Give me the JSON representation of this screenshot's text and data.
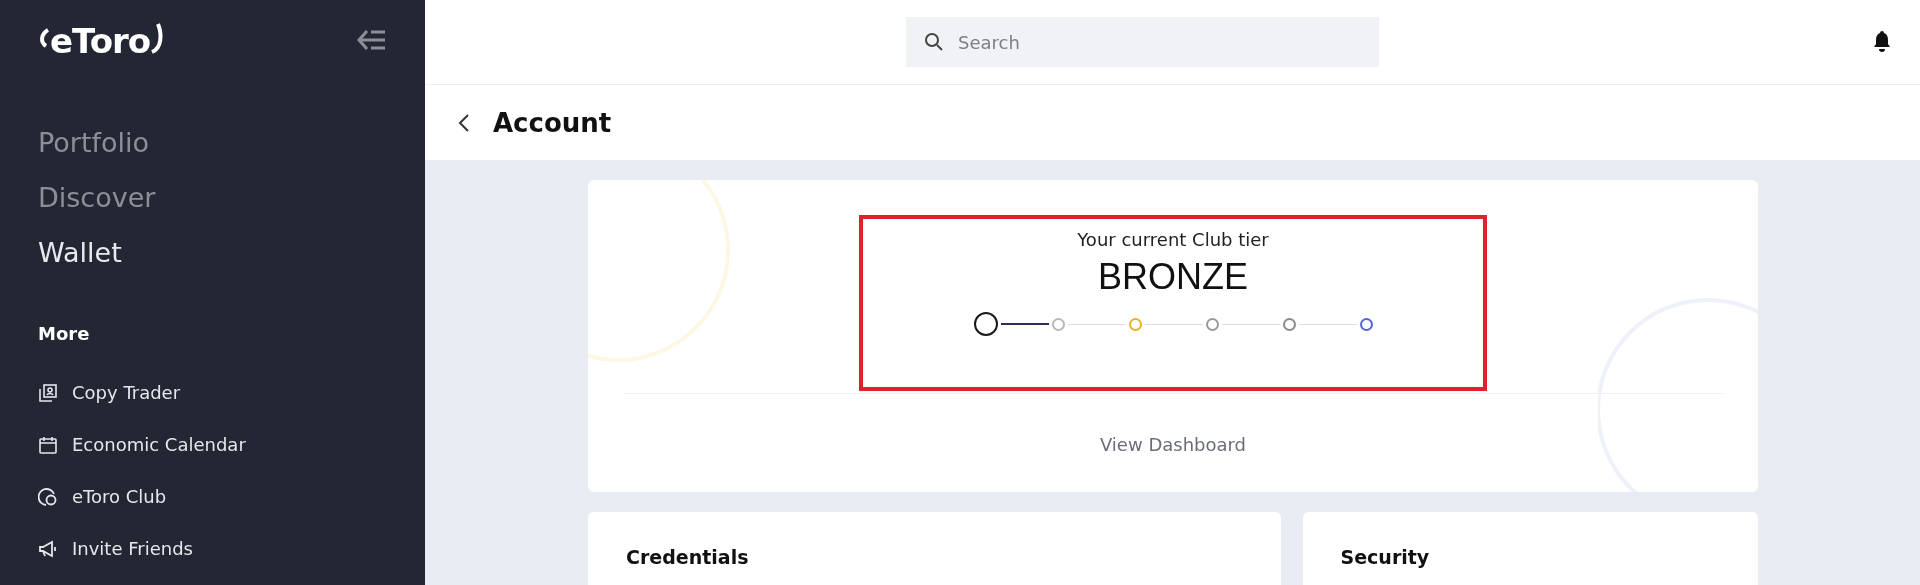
{
  "sidebar": {
    "logo": "eToro",
    "nav": [
      {
        "label": "Portfolio",
        "selected": false
      },
      {
        "label": "Discover",
        "selected": false
      },
      {
        "label": "Wallet",
        "selected": true
      }
    ],
    "more_heading": "More",
    "more_items": [
      {
        "label": "Copy Trader"
      },
      {
        "label": "Economic Calendar"
      },
      {
        "label": "eToro Club"
      },
      {
        "label": "Invite Friends"
      }
    ]
  },
  "search": {
    "placeholder": "Search"
  },
  "page": {
    "title": "Account"
  },
  "club_card": {
    "heading": "Your current Club tier",
    "tier": "BRONZE",
    "tiers": [
      {
        "color": "#1a1a1a",
        "selected": true
      },
      {
        "color": "#b8b8b8",
        "selected": false
      },
      {
        "color": "#e6b422",
        "selected": false
      },
      {
        "color": "#9a9a9a",
        "selected": false
      },
      {
        "color": "#8a8a8a",
        "selected": false
      },
      {
        "color": "#5563dd",
        "selected": false
      }
    ],
    "link": "View Dashboard"
  },
  "sections": [
    {
      "title": "Credentials"
    },
    {
      "title": "Security"
    }
  ]
}
